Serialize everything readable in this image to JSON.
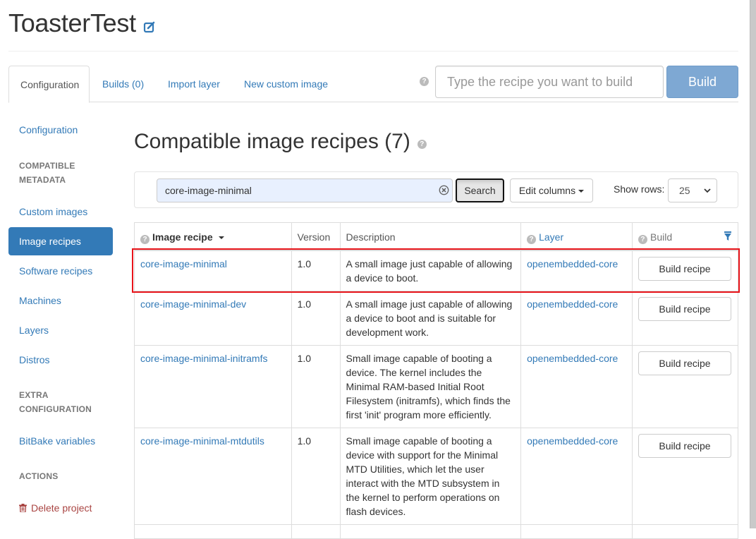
{
  "project": {
    "title": "ToasterTest"
  },
  "tabs": [
    {
      "label": "Configuration"
    },
    {
      "label": "Builds (0)"
    },
    {
      "label": "Import layer"
    },
    {
      "label": "New custom image"
    }
  ],
  "build_bar": {
    "placeholder": "Type the recipe you want to build",
    "button_label": "Build"
  },
  "sidebar": {
    "configuration": "Configuration",
    "compatible_header_1": "COMPATIBLE",
    "compatible_header_2": "METADATA",
    "custom_images": "Custom images",
    "image_recipes": "Image recipes",
    "software_recipes": "Software recipes",
    "machines": "Machines",
    "layers": "Layers",
    "distros": "Distros",
    "extra_header_1": "EXTRA",
    "extra_header_2": "CONFIGURATION",
    "bitbake_variables": "BitBake variables",
    "actions_header": "ACTIONS",
    "delete_project": "Delete project"
  },
  "main": {
    "title": "Compatible image recipes (7)"
  },
  "filter": {
    "search_value": "core-image-minimal",
    "search_button": "Search",
    "edit_columns": "Edit columns",
    "show_rows_label": "Show rows:",
    "rows_value": "25"
  },
  "table": {
    "headers": {
      "recipe": "Image recipe",
      "version": "Version",
      "description": "Description",
      "layer": "Layer",
      "build": "Build"
    },
    "rows": [
      {
        "name": "core-image-minimal",
        "version": "1.0",
        "description": "A small image just capable of allowing a device to boot.",
        "layer": "openembedded-core",
        "action": "Build recipe"
      },
      {
        "name": "core-image-minimal-dev",
        "version": "1.0",
        "description": "A small image just capable of allowing a device to boot and is suitable for development work.",
        "layer": "openembedded-core",
        "action": "Build recipe"
      },
      {
        "name": "core-image-minimal-initramfs",
        "version": "1.0",
        "description": "Small image capable of booting a device. The kernel includes the Minimal RAM-based Initial Root Filesystem (initramfs), which finds the first 'init' program more efficiently.",
        "layer": "openembedded-core",
        "action": "Build recipe"
      },
      {
        "name": "core-image-minimal-mtdutils",
        "version": "1.0",
        "description": "Small image capable of booting a device with support for the Minimal MTD Utilities, which let the user interact with the MTD subsystem in the kernel to perform operations on flash devices.",
        "layer": "openembedded-core",
        "action": "Build recipe"
      }
    ]
  },
  "colors": {
    "link": "#337ab7",
    "active": "#337ab7",
    "build_button": "#7ea8d3",
    "highlight": "#e8141a",
    "danger": "#a94442"
  }
}
